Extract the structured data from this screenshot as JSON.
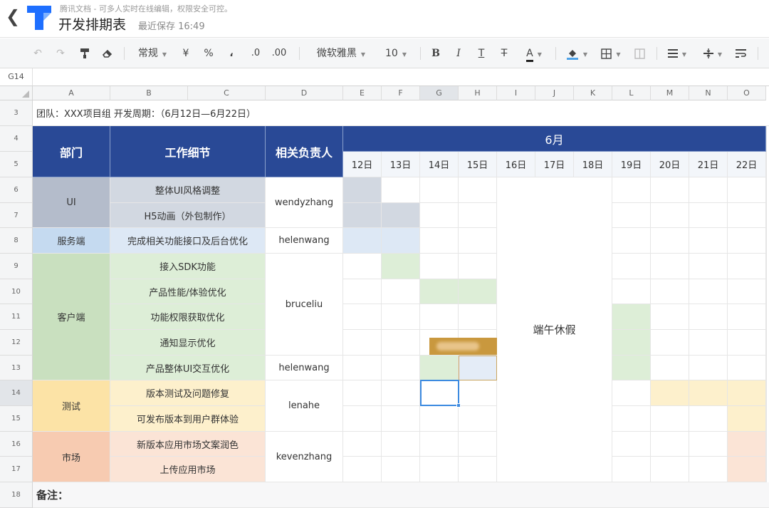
{
  "header": {
    "slogan": "腾讯文档 - 可多人实时在线编辑，权限安全可控。",
    "title": "开发排期表",
    "save_status": "最近保存 16:49"
  },
  "toolbar": {
    "number_format": "常规",
    "currency": "¥",
    "percent": "%",
    "thousands": "،",
    "decrease_decimal": ".0",
    "increase_decimal": ".00",
    "font_family": "微软雅黑",
    "font_size": "10",
    "bold": "B",
    "italic": "I",
    "underline": "T",
    "strikethrough": "T",
    "font_color_glyph": "A"
  },
  "formula_bar": {
    "cell_ref": "G14",
    "content": ""
  },
  "columns": [
    "A",
    "B",
    "C",
    "D",
    "E",
    "F",
    "G",
    "H",
    "I",
    "J",
    "K",
    "L",
    "M",
    "N",
    "O"
  ],
  "rows": [
    "3",
    "4",
    "5",
    "6",
    "7",
    "8",
    "9",
    "10",
    "11",
    "12",
    "13",
    "14",
    "15",
    "16",
    "17",
    "18"
  ],
  "sheet": {
    "info_line": "团队：XXX项目组      开发周期：（6月12日—6月22日）",
    "header": {
      "dept": "部门",
      "detail": "工作细节",
      "owner": "相关负责人",
      "month": "6月"
    },
    "days": [
      "12日",
      "13日",
      "14日",
      "15日",
      "16日",
      "17日",
      "18日",
      "19日",
      "20日",
      "21日",
      "22日"
    ],
    "holiday": "端午休假",
    "notes_label": "备注：",
    "groups": [
      {
        "dept": "UI",
        "tasks": [
          "整体UI风格调整",
          "H5动画（外包制作）"
        ],
        "owner": "wendyzhang"
      },
      {
        "dept": "服务端",
        "tasks": [
          "完成相关功能接口及后台优化"
        ],
        "owner": "helenwang"
      },
      {
        "dept": "客户端",
        "tasks": [
          "接入SDK功能",
          "产品性能/体验优化",
          "功能权限获取优化",
          "通知显示优化",
          "产品整体UI交互优化"
        ],
        "owners": [
          "bruceliu",
          "helenwang"
        ]
      },
      {
        "dept": "测试",
        "tasks": [
          "版本测试及问题修复",
          "可发布版本到用户群体验"
        ],
        "owner": "lenahe"
      },
      {
        "dept": "市场",
        "tasks": [
          "新版本应用市场文案润色",
          "上传应用市场"
        ],
        "owner": "kevenzhang"
      }
    ]
  },
  "colors": {
    "header_blue": "#294996",
    "ui": "#b4bccb",
    "ui_light": "#d2d8e1",
    "server": "#c5daf0",
    "server_light": "#dde8f5",
    "client": "#c9e0bf",
    "client_light": "#ddeed7",
    "test": "#fce3a6",
    "test_light": "#fdf0cc",
    "market": "#f7cbb1",
    "market_light": "#fbe4d6",
    "selection": "#3c8ae0"
  },
  "icons": [
    "back-arrow-icon",
    "tencent-docs-logo",
    "undo-icon",
    "redo-icon",
    "format-painter-icon",
    "eraser-icon",
    "fill-color-icon",
    "border-icon",
    "merge-cells-icon",
    "align-left-icon",
    "vertical-align-icon",
    "wrap-text-icon"
  ]
}
